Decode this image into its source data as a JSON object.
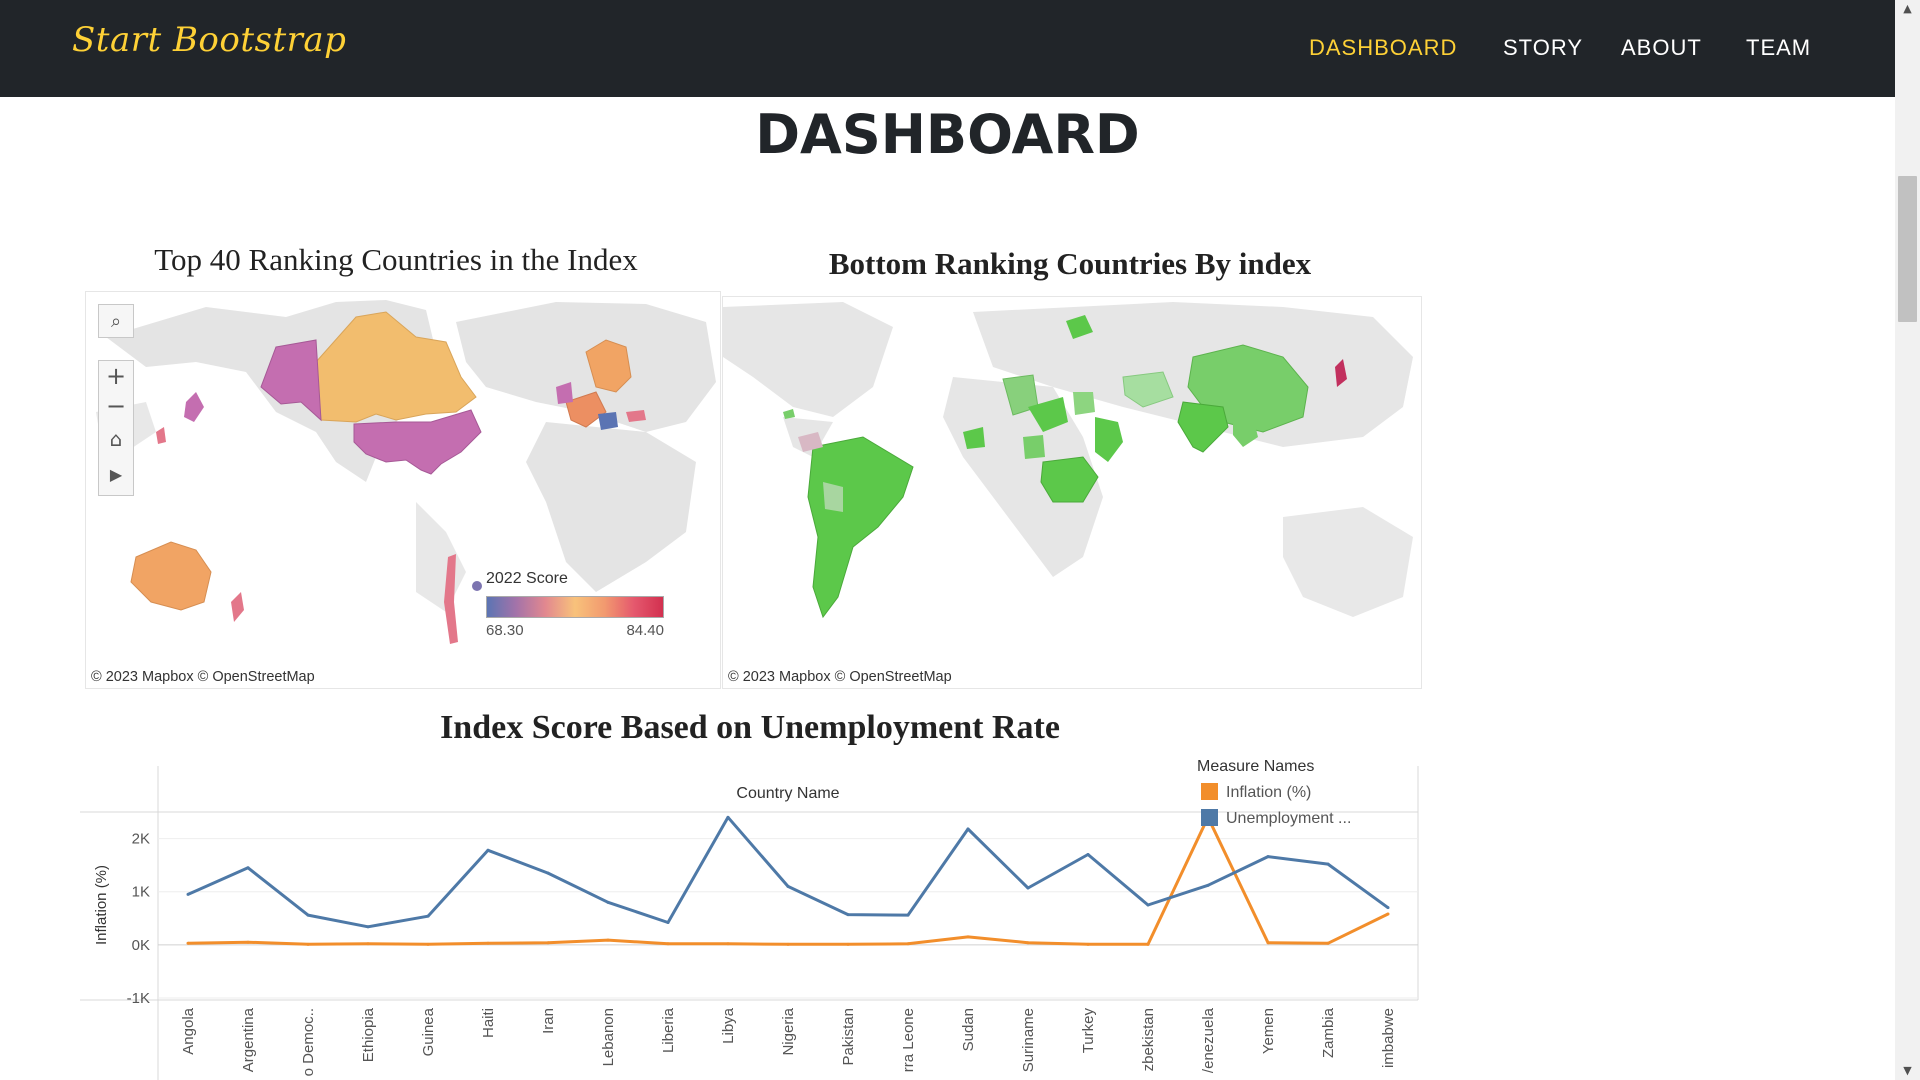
{
  "nav": {
    "brand": "Start Bootstrap",
    "links": [
      {
        "label": "DASHBOARD",
        "active": true
      },
      {
        "label": "STORY",
        "active": false
      },
      {
        "label": "ABOUT",
        "active": false
      },
      {
        "label": "TEAM",
        "active": false
      }
    ]
  },
  "page": {
    "title": "DASHBOARD"
  },
  "top_map": {
    "title": "Top 40 Ranking Countries in the Index",
    "legend_title": "2022 Score",
    "legend_min": "68.30",
    "legend_max": "84.40",
    "attribution": "© 2023 Mapbox  © OpenStreetMap",
    "tools": [
      "search-icon",
      "plus-icon",
      "minus-icon",
      "home-icon",
      "play-icon"
    ]
  },
  "bottom_map": {
    "title": "Bottom Ranking Countries By index",
    "attribution": "© 2023 Mapbox  © OpenStreetMap"
  },
  "colors": {
    "navbar": "#212529",
    "accent": "#fed136",
    "inflation": "#f28e2b",
    "unemployment": "#4e79a7",
    "map_green": "#5cc84a"
  },
  "chart_data": {
    "type": "line",
    "title": "Index Score Based on Unemployment Rate",
    "header": "Country Name",
    "ylabel": "Inflation (%)",
    "legend_title": "Measure Names",
    "legend_items": [
      "Inflation (%)",
      "Unemployment ..."
    ],
    "y_ticks": [
      "2K",
      "1K",
      "0K",
      "-1K"
    ],
    "ylim": [
      -1000,
      2500
    ],
    "categories": [
      "Angola",
      "Argentina",
      "o Democ..",
      "Ethiopia",
      "Guinea",
      "Haiti",
      "Iran",
      "Lebanon",
      "Liberia",
      "Libya",
      "Nigeria",
      "Pakistan",
      "rra Leone",
      "Sudan",
      "Suriname",
      "Turkey",
      "zbekistan",
      "/enezuela",
      "Yemen",
      "Zambia",
      "imbabwe"
    ],
    "series": [
      {
        "name": "Inflation (%)",
        "color": "#f28e2b",
        "values": [
          30,
          50,
          10,
          20,
          10,
          30,
          40,
          90,
          20,
          20,
          10,
          10,
          20,
          150,
          40,
          10,
          10,
          2400,
          40,
          30,
          580
        ]
      },
      {
        "name": "Unemployment ...",
        "color": "#4e79a7",
        "values": [
          950,
          1450,
          560,
          340,
          540,
          1780,
          1350,
          800,
          420,
          2400,
          1100,
          570,
          560,
          2180,
          1070,
          1700,
          750,
          1120,
          1660,
          1520,
          700
        ]
      }
    ]
  }
}
